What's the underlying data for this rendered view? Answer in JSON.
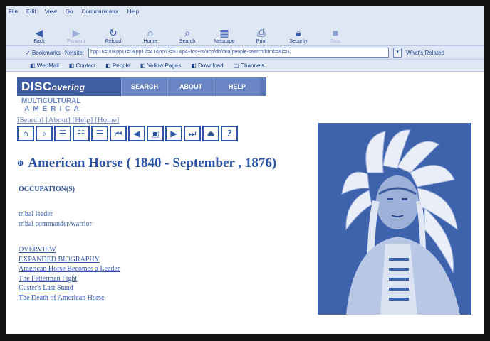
{
  "browser": {
    "menu": [
      "File",
      "Edit",
      "View",
      "Go",
      "Communicator",
      "Help"
    ],
    "nav_buttons": [
      {
        "label": "Back",
        "icon": "back-arrow-icon"
      },
      {
        "label": "Forward",
        "icon": "forward-arrow-icon"
      },
      {
        "label": "Reload",
        "icon": "reload-icon"
      },
      {
        "label": "Home",
        "icon": "home-icon"
      },
      {
        "label": "Search",
        "icon": "search-icon"
      },
      {
        "label": "Netscape",
        "icon": "netscape-icon"
      },
      {
        "label": "Print",
        "icon": "print-icon"
      },
      {
        "label": "Security",
        "icon": "security-lock-icon"
      },
      {
        "label": "Stop",
        "icon": "stop-icon"
      }
    ],
    "bookmarks_label": "Bookmarks",
    "location_label": "Netsite:",
    "location_url": "hpp16=00&pp11=0&pp12=4T&pp13=8T&p4+fos+rs/acp/db/dna/people-search/html=t&i=G",
    "whats_related": "What's Related",
    "personal_toolbar": [
      "WebMail",
      "Contact",
      "People",
      "Yellow Pages",
      "Download",
      "Channels"
    ]
  },
  "site": {
    "logo_main": "DISC",
    "logo_rest": "overing",
    "nav": [
      "SEARCH",
      "ABOUT",
      "HELP"
    ],
    "subtitle_line1": "MULTICULTURAL",
    "subtitle_line2": "AMERICA",
    "text_nav": "[Search] [About] [Help] [Home]",
    "icon_toolbar": [
      {
        "name": "home-icon",
        "glyph": "⌂"
      },
      {
        "name": "search-icon",
        "glyph": "⌕"
      },
      {
        "name": "list-icon",
        "glyph": "☰"
      },
      {
        "name": "list-detail-icon",
        "glyph": "☷"
      },
      {
        "name": "list-bullets-icon",
        "glyph": "☰"
      },
      {
        "name": "first-icon",
        "glyph": "⏮"
      },
      {
        "name": "previous-icon",
        "glyph": "◀"
      },
      {
        "name": "document-icon",
        "glyph": "▣"
      },
      {
        "name": "next-icon",
        "glyph": "▶"
      },
      {
        "name": "last-icon",
        "glyph": "⏭"
      },
      {
        "name": "collapse-icon",
        "glyph": "⏏"
      },
      {
        "name": "help-icon",
        "glyph": "?"
      }
    ]
  },
  "entry": {
    "title": "American Horse ( 1840 - September , 1876)",
    "occupation_heading": "OCCUPATION(S)",
    "occupations": [
      "tribal leader",
      "tribal commander/warrior"
    ],
    "links": [
      "OVERVIEW",
      "EXPANDED BIOGRAPHY",
      "American Horse Becomes a Leader",
      "The Fetterman Fight",
      "Custer's Last Stand",
      "The Death of American Horse"
    ],
    "photo_icon": "portrait-photo"
  }
}
